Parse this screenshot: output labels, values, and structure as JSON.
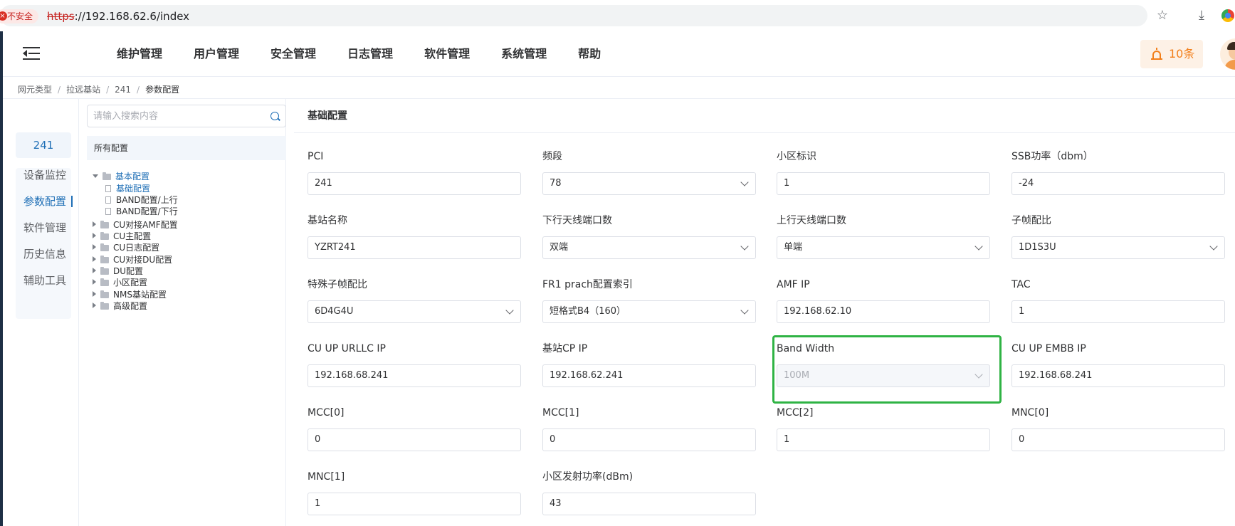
{
  "browser": {
    "insecure_label": "不安全",
    "url_scheme": "https",
    "url_rest": "://192.168.62.6/index"
  },
  "header": {
    "nav": [
      "维护管理",
      "用户管理",
      "安全管理",
      "日志管理",
      "软件管理",
      "系统管理",
      "帮助"
    ],
    "alarm_count": "10条"
  },
  "breadcrumb": [
    "网元类型",
    "拉远基站",
    "241",
    "参数配置"
  ],
  "sidebar": {
    "device": "241",
    "items": [
      "设备监控",
      "参数配置",
      "软件管理",
      "历史信息",
      "辅助工具"
    ],
    "active": "参数配置"
  },
  "tree": {
    "search_placeholder": "请输入搜索内容",
    "title": "所有配置",
    "nodes": [
      {
        "label": "基本配置",
        "kind": "folder-open"
      },
      {
        "label": "基础配置",
        "kind": "file",
        "selected": true
      },
      {
        "label": "BAND配置/上行",
        "kind": "file"
      },
      {
        "label": "BAND配置/下行",
        "kind": "file"
      },
      {
        "label": "CU对接AMF配置",
        "kind": "folder"
      },
      {
        "label": "CU主配置",
        "kind": "folder"
      },
      {
        "label": "CU日志配置",
        "kind": "folder"
      },
      {
        "label": "CU对接DU配置",
        "kind": "folder"
      },
      {
        "label": "DU配置",
        "kind": "folder"
      },
      {
        "label": "小区配置",
        "kind": "folder"
      },
      {
        "label": "NMS基站配置",
        "kind": "folder"
      },
      {
        "label": "高级配置",
        "kind": "folder"
      }
    ]
  },
  "main": {
    "title": "基础配置",
    "fields": [
      {
        "label": "PCI",
        "value": "241",
        "type": "input"
      },
      {
        "label": "频段",
        "value": "78",
        "type": "select"
      },
      {
        "label": "小区标识",
        "value": "1",
        "type": "input"
      },
      {
        "label": "SSB功率（dbm）",
        "value": "-24",
        "type": "input"
      },
      {
        "label": "基站名称",
        "value": "YZRT241",
        "type": "input"
      },
      {
        "label": "下行天线端口数",
        "value": "双端",
        "type": "select"
      },
      {
        "label": "上行天线端口数",
        "value": "单端",
        "type": "select"
      },
      {
        "label": "子帧配比",
        "value": "1D1S3U",
        "type": "select"
      },
      {
        "label": "特殊子帧配比",
        "value": "6D4G4U",
        "type": "select"
      },
      {
        "label": "FR1 prach配置索引",
        "value": "短格式B4（160）",
        "type": "select"
      },
      {
        "label": "AMF IP",
        "value": "192.168.62.10",
        "type": "input"
      },
      {
        "label": "TAC",
        "value": "1",
        "type": "input"
      },
      {
        "label": "CU UP URLLC IP",
        "value": "192.168.68.241",
        "type": "input"
      },
      {
        "label": "基站CP IP",
        "value": "192.168.62.241",
        "type": "input"
      },
      {
        "label": "Band Width",
        "value": "100M",
        "type": "select-disabled"
      },
      {
        "label": "CU UP EMBB IP",
        "value": "192.168.68.241",
        "type": "input"
      },
      {
        "label": "MCC[0]",
        "value": "0",
        "type": "input"
      },
      {
        "label": "MCC[1]",
        "value": "0",
        "type": "input"
      },
      {
        "label": "MCC[2]",
        "value": "1",
        "type": "input"
      },
      {
        "label": "MNC[0]",
        "value": "0",
        "type": "input"
      },
      {
        "label": "MNC[1]",
        "value": "1",
        "type": "input"
      },
      {
        "label": "小区发射功率(dBm)",
        "value": "43",
        "type": "input"
      }
    ]
  },
  "colors": {
    "primary": "#1f6fb6",
    "alarm": "#f27f1b",
    "highlight": "#2fb344"
  }
}
